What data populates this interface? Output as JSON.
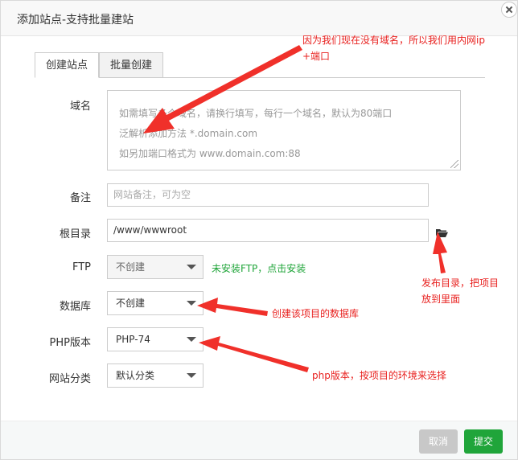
{
  "dialog": {
    "title": "添加站点-支持批量建站",
    "close_icon": "close-icon"
  },
  "tabs": [
    {
      "label": "创建站点",
      "active": true
    },
    {
      "label": "批量创建",
      "active": false
    }
  ],
  "form": {
    "domain": {
      "label": "域名",
      "placeholder_lines": [
        "如需填写多个域名，请换行填写，每行一个域名，默认为80端口",
        "泛解析添加方法 *.domain.com",
        "如另加端口格式为 www.domain.com:88"
      ]
    },
    "remark": {
      "label": "备注",
      "placeholder": "网站备注，可为空"
    },
    "root": {
      "label": "根目录",
      "value": "/www/wwwroot",
      "icon": "folder-icon"
    },
    "ftp": {
      "label": "FTP",
      "selected": "不创建",
      "notice": "未安装FTP，点击安装"
    },
    "database": {
      "label": "数据库",
      "selected": "不创建"
    },
    "php": {
      "label": "PHP版本",
      "selected": "PHP-74"
    },
    "category": {
      "label": "网站分类",
      "selected": "默认分类"
    }
  },
  "annotations": {
    "domain_note_line1": "因为我们现在没有域名，所以我们用内网ip",
    "domain_note_line2": "+端口",
    "root_note_line1": "发布目录，把项目",
    "root_note_line2": "放到里面",
    "database_note": "创建该项目的数据库",
    "php_note": "php版本，按项目的环境来选择",
    "color": "#e8211f"
  },
  "footer": {
    "cancel_label": "取消",
    "submit_label": "提交",
    "submit_color": "#20a53a"
  }
}
